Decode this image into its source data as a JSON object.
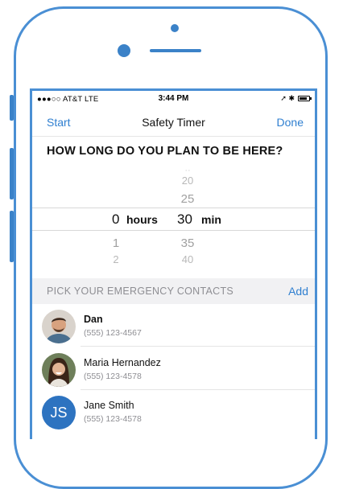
{
  "status_bar": {
    "carrier": "●●●○○ AT&T  LTE",
    "time": "3:44 PM",
    "icons": "➚ ✱"
  },
  "nav": {
    "start_label": "Start",
    "title": "Safety Timer",
    "done_label": "Done"
  },
  "question": "HOW LONG DO YOU PLAN TO BE HERE?",
  "picker": {
    "hours": {
      "above": "",
      "selected": "0",
      "unit": "hours",
      "below": [
        "1",
        "2"
      ]
    },
    "minutes": {
      "above": [
        "20",
        "25"
      ],
      "selected": "30",
      "unit": "min",
      "below": [
        "35",
        "40"
      ]
    }
  },
  "contacts_section": {
    "title": "PICK YOUR EMERGENCY CONTACTS",
    "add_label": "Add"
  },
  "contacts": [
    {
      "name": "Dan",
      "phone": "(555) 123-4567"
    },
    {
      "name": "Maria Hernandez",
      "phone": "(555) 123-4578"
    },
    {
      "name": "Jane Smith",
      "phone": "(555) 123-4578",
      "initials": "JS"
    }
  ],
  "colors": {
    "accent": "#2f7fd0",
    "frame": "#4a8fd4",
    "avatar_js": "#2d73c0"
  }
}
